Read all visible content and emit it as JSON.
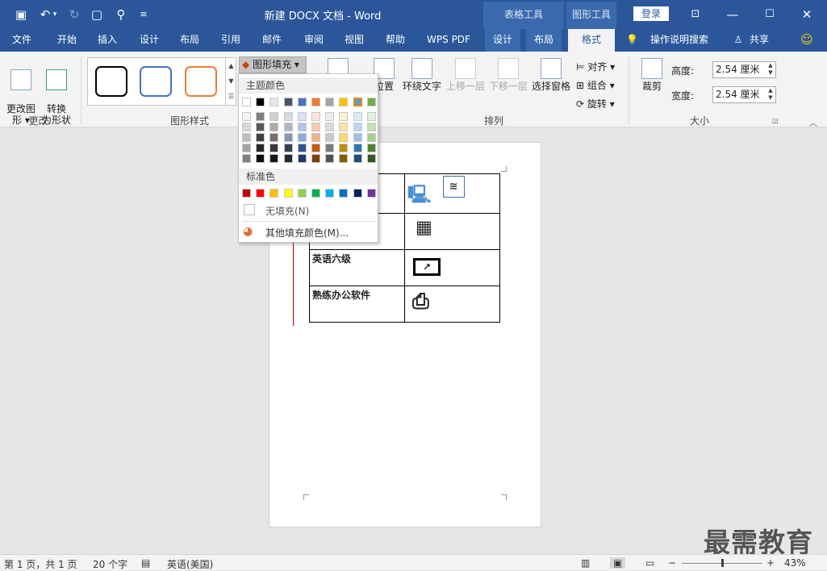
{
  "window": {
    "title": "新建 DOCX 文档  -  Word",
    "login": "登录"
  },
  "context_groups": {
    "table_tools": "表格工具",
    "drawing_tools": "图形工具"
  },
  "tabs": [
    "文件",
    "开始",
    "插入",
    "设计",
    "布局",
    "引用",
    "邮件",
    "审阅",
    "视图",
    "帮助",
    "WPS PDF",
    "设计",
    "布局",
    "格式"
  ],
  "tell_me": "操作说明搜索",
  "share": "共享",
  "ribbon": {
    "change_shape": "更改图\n形 ▾",
    "convert": "转换\n为形状",
    "group_change": "更改",
    "group_styles": "图形样式",
    "fill_button": "图形填充 ▾",
    "position": "位置",
    "wrap_text": "环绕文字",
    "bring_forward": "上移一层",
    "send_backward": "下移一层",
    "selection_pane": "选择窗格",
    "align": "对齐 ▾",
    "group": "组合 ▾",
    "rotate": "旋转 ▾",
    "group_arrange": "排列",
    "crop": "裁剪",
    "height_label": "高度:",
    "height_value": "2.54 厘米",
    "width_label": "宽度:",
    "width_value": "2.54 厘米",
    "group_size": "大小"
  },
  "shape_style_colors": [
    "#000000",
    "#4472c4",
    "#ed7d31"
  ],
  "dropdown": {
    "theme_colors_label": "主题颜色",
    "standard_colors_label": "标准色",
    "no_fill": "无填充(N)",
    "more_colors": "其他填充颜色(M)...",
    "theme_colors": [
      "#ffffff",
      "#000000",
      "#e7e6e6",
      "#44546a",
      "#4472c4",
      "#ed7d31",
      "#a5a5a5",
      "#ffc000",
      "#5b9bd5",
      "#70ad47"
    ],
    "theme_shades": [
      [
        "#f2f2f2",
        "#7f7f7f",
        "#d0cece",
        "#d6dce4",
        "#d9e2f3",
        "#fbe5d5",
        "#ededed",
        "#fff2cc",
        "#deebf6",
        "#e2efd9"
      ],
      [
        "#d8d8d8",
        "#595959",
        "#aeabab",
        "#adb9ca",
        "#b4c6e7",
        "#f7cbac",
        "#dbdbdb",
        "#fee599",
        "#bdd7ee",
        "#c5e0b3"
      ],
      [
        "#bfbfbf",
        "#3f3f3f",
        "#757070",
        "#8496b0",
        "#8eaadb",
        "#f4b183",
        "#c9c9c9",
        "#ffd965",
        "#9cc3e5",
        "#a8d08d"
      ],
      [
        "#a5a5a5",
        "#262626",
        "#3a3838",
        "#323f4f",
        "#2f5496",
        "#c55a11",
        "#7b7b7b",
        "#bf9000",
        "#2e75b5",
        "#538135"
      ],
      [
        "#7f7f7f",
        "#0c0c0c",
        "#171616",
        "#222a35",
        "#1f3864",
        "#833c0b",
        "#525252",
        "#7f6000",
        "#1e4e79",
        "#375623"
      ]
    ],
    "standard_colors": [
      "#c00000",
      "#ff0000",
      "#ffc000",
      "#ffff00",
      "#92d050",
      "#00b050",
      "#00b0f0",
      "#0070c0",
      "#002060",
      "#7030a0"
    ]
  },
  "document": {
    "rows": [
      "",
      "",
      "英语六级",
      "熟练办公软件"
    ]
  },
  "status": {
    "page": "第 1 页，共 1 页",
    "words": "20 个字",
    "lang": "英语(美国)",
    "zoom": "43%"
  },
  "watermark": "最需教育"
}
